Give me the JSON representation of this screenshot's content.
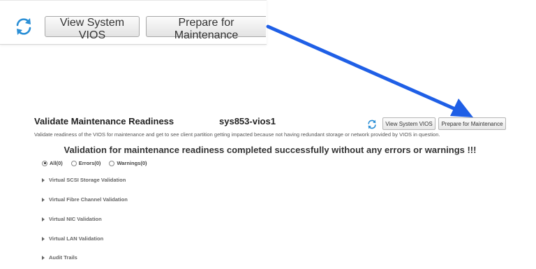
{
  "zoom_toolbar": {
    "view_system_vios": "View System VIOS",
    "prepare_for_maintenance": "Prepare for Maintenance"
  },
  "header": {
    "title": "Validate Maintenance Readiness",
    "vios_name": "sys853-vios1",
    "description": "Validate readiness of the VIOS for maintenance and get to see client partition getting impacted because not having redundant storage or network provided by VIOS in question."
  },
  "toolbar": {
    "view_system_vios": "View System VIOS",
    "prepare_for_maintenance": "Prepare for Maintenance"
  },
  "status_message": "Validation for maintenance readiness completed successfully without any errors or warnings !!!",
  "filters": [
    {
      "label": "All(0)",
      "selected": true
    },
    {
      "label": "Errors(0)",
      "selected": false
    },
    {
      "label": "Warnings(0)",
      "selected": false
    }
  ],
  "sections": [
    "Virtual SCSI Storage Validation",
    "Virtual Fibre Channel Validation",
    "Virtual NIC Validation",
    "Virtual LAN Validation",
    "Audit Trails"
  ],
  "colors": {
    "arrow": "#1f5fe6",
    "refresh_icon": "#2b8fd6"
  }
}
